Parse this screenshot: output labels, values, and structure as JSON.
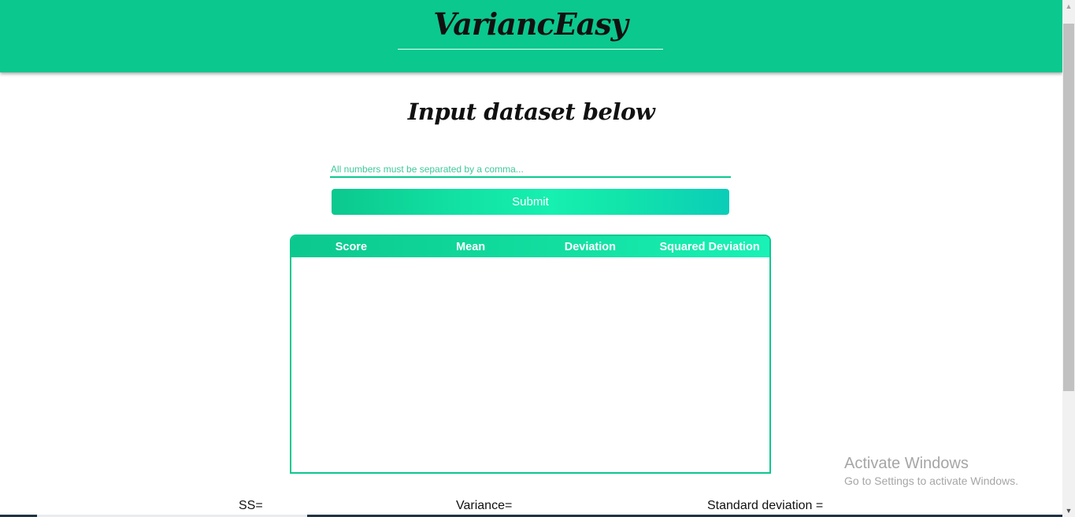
{
  "header": {
    "brand": "VariancEasy"
  },
  "main": {
    "heading": "Input dataset below",
    "input_placeholder": "All numbers must be separated by a comma...",
    "submit_label": "Submit"
  },
  "table": {
    "columns": [
      "Score",
      "Mean",
      "Deviation",
      "Squared Deviation"
    ],
    "rows": []
  },
  "stats": {
    "ss_label": "SS=",
    "variance_label": "Variance=",
    "std_label": "Standard deviation ="
  },
  "watermark": {
    "title": "Activate Windows",
    "subtitle": "Go to Settings to activate Windows."
  },
  "colors": {
    "accent": "#0bc88e"
  },
  "icons": {
    "scroll_up": "chevron-up-icon",
    "scroll_down": "chevron-down-icon"
  }
}
